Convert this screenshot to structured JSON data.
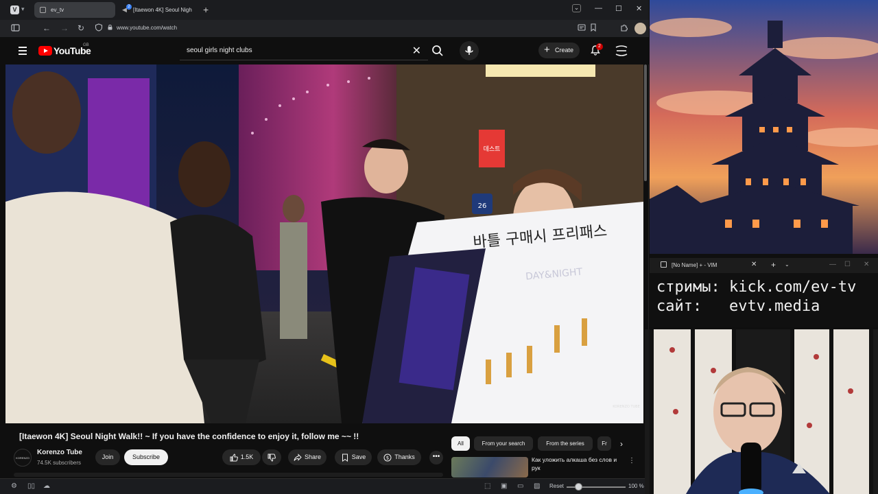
{
  "browser": {
    "tabs": [
      {
        "label": "ev_tv",
        "active": true
      },
      {
        "label": "[Itaewon 4K] Seoul Nigh",
        "active": false,
        "badge": "2"
      }
    ],
    "url": "www.youtube.com/watch",
    "new_tab": "+",
    "window_controls": {
      "dropdown": "⌄",
      "minimize": "—",
      "maximize": "☐",
      "close": "✕"
    },
    "nav": {
      "back": "←",
      "forward": "→",
      "reload": "↻"
    }
  },
  "youtube": {
    "logo_text": "YouTube",
    "country_code": "GB",
    "search_value": "seoul girls night clubs",
    "create_label": "Create",
    "notifications_count": "2",
    "video": {
      "title": "[Itaewon 4K]  Seoul Night Walk!! ~ If you have the confidence to enjoy it, follow me ~~ !!",
      "sign_text": "바틀 구매시 프리패스",
      "menu_brand": "DAY&NIGHT",
      "sign_number": "26",
      "red_sign": "데스트",
      "watermark": "KORENZO TUBE"
    },
    "channel": {
      "name": "Korenzo Tube",
      "subscribers": "74.5K subscribers",
      "avatar_text": "KORENZO TUBE",
      "join_label": "Join",
      "subscribe_label": "Subscribe"
    },
    "actions": {
      "like_count": "1.5K",
      "share_label": "Share",
      "save_label": "Save",
      "thanks_label": "Thanks",
      "more_label": "•••"
    },
    "chips": [
      "All",
      "From your search",
      "From the series",
      "Fr"
    ],
    "chip_next": "›",
    "recommended": [
      {
        "title": "Как уложить алкаша без слов и рук"
      }
    ]
  },
  "statusbar": {
    "reset_label": "Reset",
    "zoom_label": "100 %",
    "zoom_level": 100
  },
  "stream": {
    "vim_title": "[No Name] + - VIM",
    "vim_close": "✕",
    "vim_new_tab": "+",
    "vim_dropdown": "⌄",
    "vim_lines": [
      "стримы: kick.com/ev-tv",
      "сайт:   evtv.media"
    ]
  },
  "colors": {
    "yt_red": "#ff0000",
    "background": "#0f0f0f",
    "chip_bg": "#272727",
    "text": "#f1f1f1"
  },
  "icons": [
    "hamburger-menu-icon",
    "search-icon",
    "mic-icon",
    "bell-icon",
    "like-icon",
    "dislike-icon",
    "share-icon",
    "save-icon",
    "thanks-icon",
    "more-icon",
    "chevron-right-icon",
    "lock-icon",
    "reload-icon",
    "back-icon",
    "forward-icon"
  ]
}
